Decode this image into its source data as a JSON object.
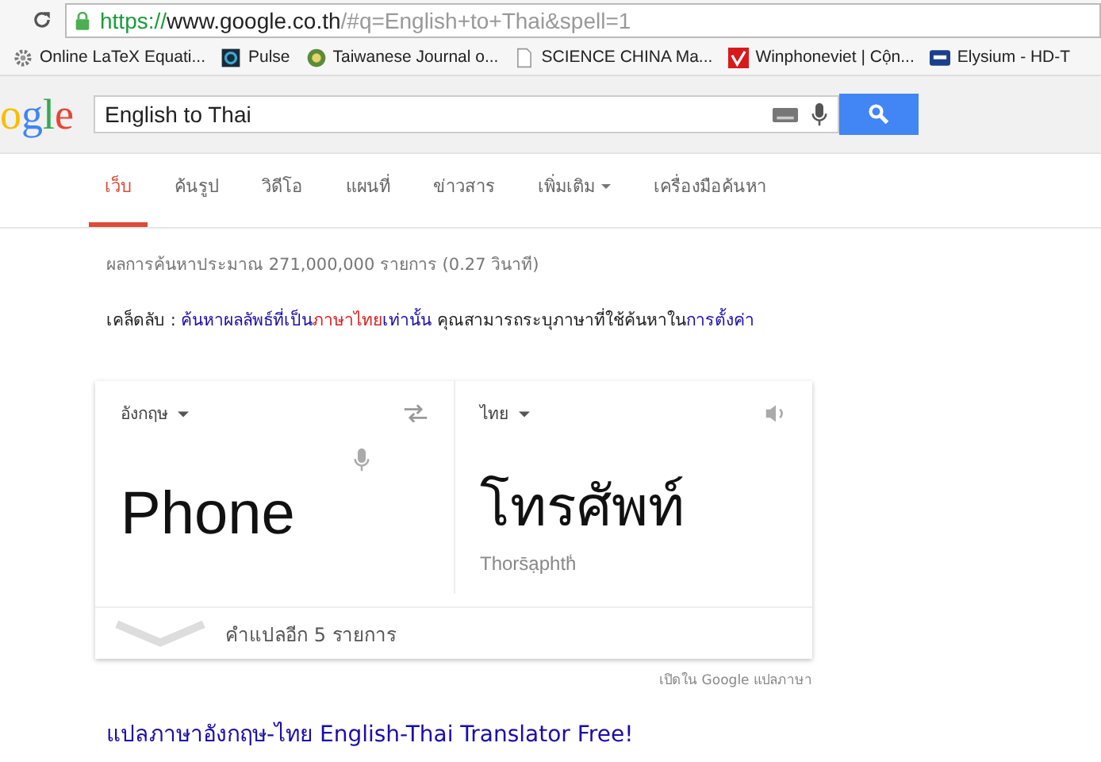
{
  "browser": {
    "url": {
      "scheme": "https://",
      "host": "www.google.co.th",
      "path": "/#q=English+to+Thai&spell=1"
    },
    "bookmarks": [
      {
        "kind": "gear",
        "label": "Online LaTeX Equati..."
      },
      {
        "kind": "square",
        "label": "Pulse"
      },
      {
        "kind": "globe",
        "label": "Taiwanese Journal o..."
      },
      {
        "kind": "page",
        "label": "SCIENCE CHINA Ma..."
      },
      {
        "kind": "check",
        "label": "Winphoneviet | Cộn..."
      },
      {
        "kind": "hd",
        "label": "Elysium - HD-T"
      }
    ]
  },
  "header": {
    "logo": [
      {
        "text": "o",
        "color": "#fbbc05"
      },
      {
        "text": "g",
        "color": "#4285f4"
      },
      {
        "text": "l",
        "color": "#34a853"
      },
      {
        "text": "e",
        "color": "#ea4335"
      }
    ],
    "query": "English to Thai"
  },
  "tabs": [
    {
      "label": "เว็บ",
      "selected": true,
      "kind": "plain"
    },
    {
      "label": "ค้นรูป",
      "selected": false,
      "kind": "plain"
    },
    {
      "label": "วิดีโอ",
      "selected": false,
      "kind": "plain"
    },
    {
      "label": "แผนที่",
      "selected": false,
      "kind": "plain"
    },
    {
      "label": "ข่าวสาร",
      "selected": false,
      "kind": "plain"
    },
    {
      "label": "เพิ่มเติม",
      "selected": false,
      "kind": "dropdown"
    },
    {
      "label": "เครื่องมือค้นหา",
      "selected": false,
      "kind": "plain"
    }
  ],
  "result_stats": "ผลการค้นหาประมาณ 271,000,000 รายการ (0.27 วินาที)",
  "tip": [
    {
      "kind": "plain",
      "text": "เคล็ดลับ : "
    },
    {
      "kind": "link",
      "parts": [
        {
          "text": "ค้นหาผลลัพธ์ที่เป็น",
          "emphasis": false
        },
        {
          "text": "ภาษาไทย",
          "emphasis": true
        },
        {
          "text": "เท่านั้น",
          "emphasis": false
        }
      ]
    },
    {
      "kind": "plain",
      "text": " คุณสามารถระบุภาษาที่ใช้ค้นหาใน"
    },
    {
      "kind": "link",
      "parts": [
        {
          "text": "การตั้งค่า",
          "emphasis": false
        }
      ]
    }
  ],
  "translator": {
    "source_language": "อังกฤษ",
    "target_language": "ไทย",
    "source_text": "Phone",
    "translation": "โทรศัพท์",
    "transliteration": "Thors̄ạphth̒",
    "more": "คำแปลอีก 5 รายการ",
    "open_link": "เปิดใน Google แปลภาษา"
  },
  "result_title": "แปลภาษาอังกฤษ-ไทย English-Thai Translator Free!"
}
